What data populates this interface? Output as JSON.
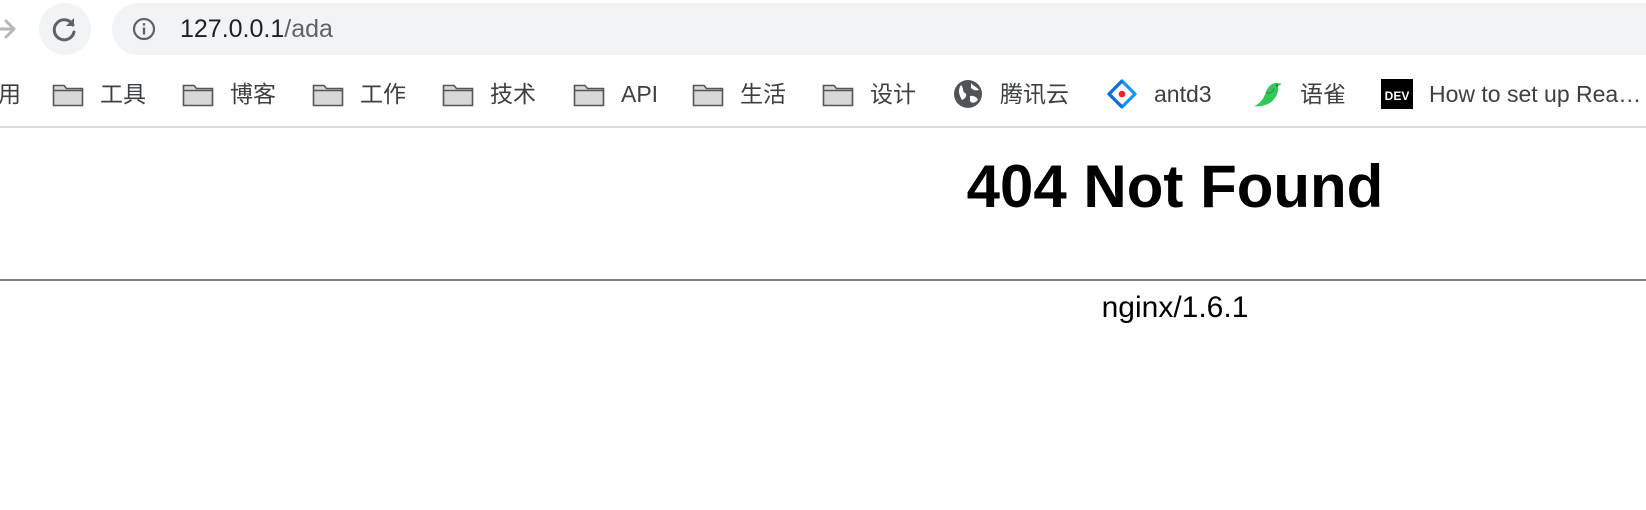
{
  "browser": {
    "address_host": "127.0.0.1",
    "address_path": "/ada"
  },
  "bookmarks": [
    {
      "label": "用",
      "icon": "folder-icon"
    },
    {
      "label": "工具",
      "icon": "folder-icon"
    },
    {
      "label": "博客",
      "icon": "folder-icon"
    },
    {
      "label": "工作",
      "icon": "folder-icon"
    },
    {
      "label": "技术",
      "icon": "folder-icon"
    },
    {
      "label": "API",
      "icon": "folder-icon"
    },
    {
      "label": "生活",
      "icon": "folder-icon"
    },
    {
      "label": "设计",
      "icon": "folder-icon"
    },
    {
      "label": "腾讯云",
      "icon": "globe-icon"
    },
    {
      "label": "antd3",
      "icon": "antd-logo-icon"
    },
    {
      "label": "语雀",
      "icon": "yuque-bird-icon"
    },
    {
      "label": "How to set up Rea…",
      "icon": "dev-logo-icon",
      "icon_text": "DEV"
    }
  ],
  "page": {
    "heading": "404 Not Found",
    "server": "nginx/1.6.1"
  }
}
